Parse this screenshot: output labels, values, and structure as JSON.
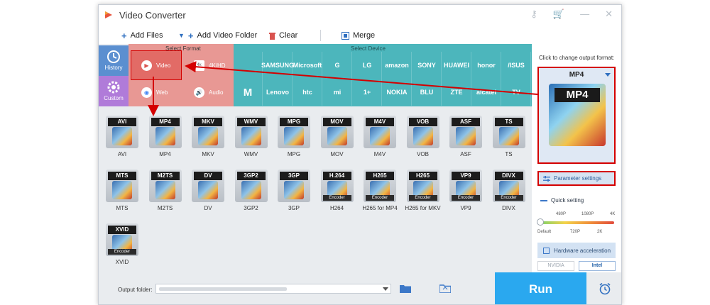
{
  "window": {
    "title": "Video Converter"
  },
  "toolbar": {
    "add_files": "Add Files",
    "add_video_folder": "Add Video Folder",
    "clear": "Clear",
    "merge": "Merge"
  },
  "nav": {
    "history": "History",
    "custom": "Custom"
  },
  "zones": {
    "select_format": "Select Format",
    "select_device": "Select Device"
  },
  "format_categories": {
    "video": "Video",
    "4khd": "4K/HD",
    "web": "Web",
    "audio": "Audio"
  },
  "devices_row1": [
    "",
    "SAMSUNG",
    "Microsoft",
    "G",
    "LG",
    "amazon",
    "SONY",
    "HUAWEI",
    "honor",
    "/ISUS"
  ],
  "devices_row2": [
    "",
    "Lenovo",
    "htc",
    "mi",
    "1+",
    "NOKIA",
    "BLU",
    "ZTE",
    "alcatel",
    "TV"
  ],
  "formats": [
    {
      "tag": "AVI",
      "name": "AVI"
    },
    {
      "tag": "MP4",
      "name": "MP4"
    },
    {
      "tag": "MKV",
      "name": "MKV"
    },
    {
      "tag": "WMV",
      "name": "WMV"
    },
    {
      "tag": "MPG",
      "name": "MPG"
    },
    {
      "tag": "MOV",
      "name": "MOV"
    },
    {
      "tag": "M4V",
      "name": "M4V"
    },
    {
      "tag": "VOB",
      "name": "VOB"
    },
    {
      "tag": "ASF",
      "name": "ASF"
    },
    {
      "tag": "TS",
      "name": "TS"
    },
    {
      "tag": "MTS",
      "name": "MTS"
    },
    {
      "tag": "M2TS",
      "name": "M2TS"
    },
    {
      "tag": "DV",
      "name": "DV"
    },
    {
      "tag": "3GP2",
      "name": "3GP2"
    },
    {
      "tag": "3GP",
      "name": "3GP"
    },
    {
      "tag": "H.264",
      "name": "H264",
      "enc": "Encoder"
    },
    {
      "tag": "H265",
      "name": "H265 for MP4",
      "enc": "Encoder"
    },
    {
      "tag": "H265",
      "name": "H265 for MKV",
      "enc": "Encoder"
    },
    {
      "tag": "VP9",
      "name": "VP9",
      "enc": "Encoder"
    },
    {
      "tag": "DIVX",
      "name": "DIVX",
      "enc": "Encoder"
    },
    {
      "tag": "XVID",
      "name": "XVID",
      "enc": "Encoder"
    }
  ],
  "right_panel": {
    "hint": "Click to change output format:",
    "selected_format": "MP4",
    "big_icon_tag": "MP4",
    "parameter_settings": "Parameter settings",
    "quick_setting": "Quick setting",
    "slider_top": [
      "480P",
      "1080P",
      "4K"
    ],
    "slider_bottom": [
      "Default",
      "720P",
      "2K"
    ],
    "hardware_acceleration": "Hardware acceleration",
    "vendors": [
      "NVIDIA",
      "Intel"
    ]
  },
  "bottom": {
    "output_folder_label": "Output folder:",
    "run": "Run"
  },
  "colors": {
    "format_zone": "#e89894",
    "device_zone": "#4cb6bc",
    "run_button": "#2aa8ef",
    "highlight": "#d40000"
  }
}
